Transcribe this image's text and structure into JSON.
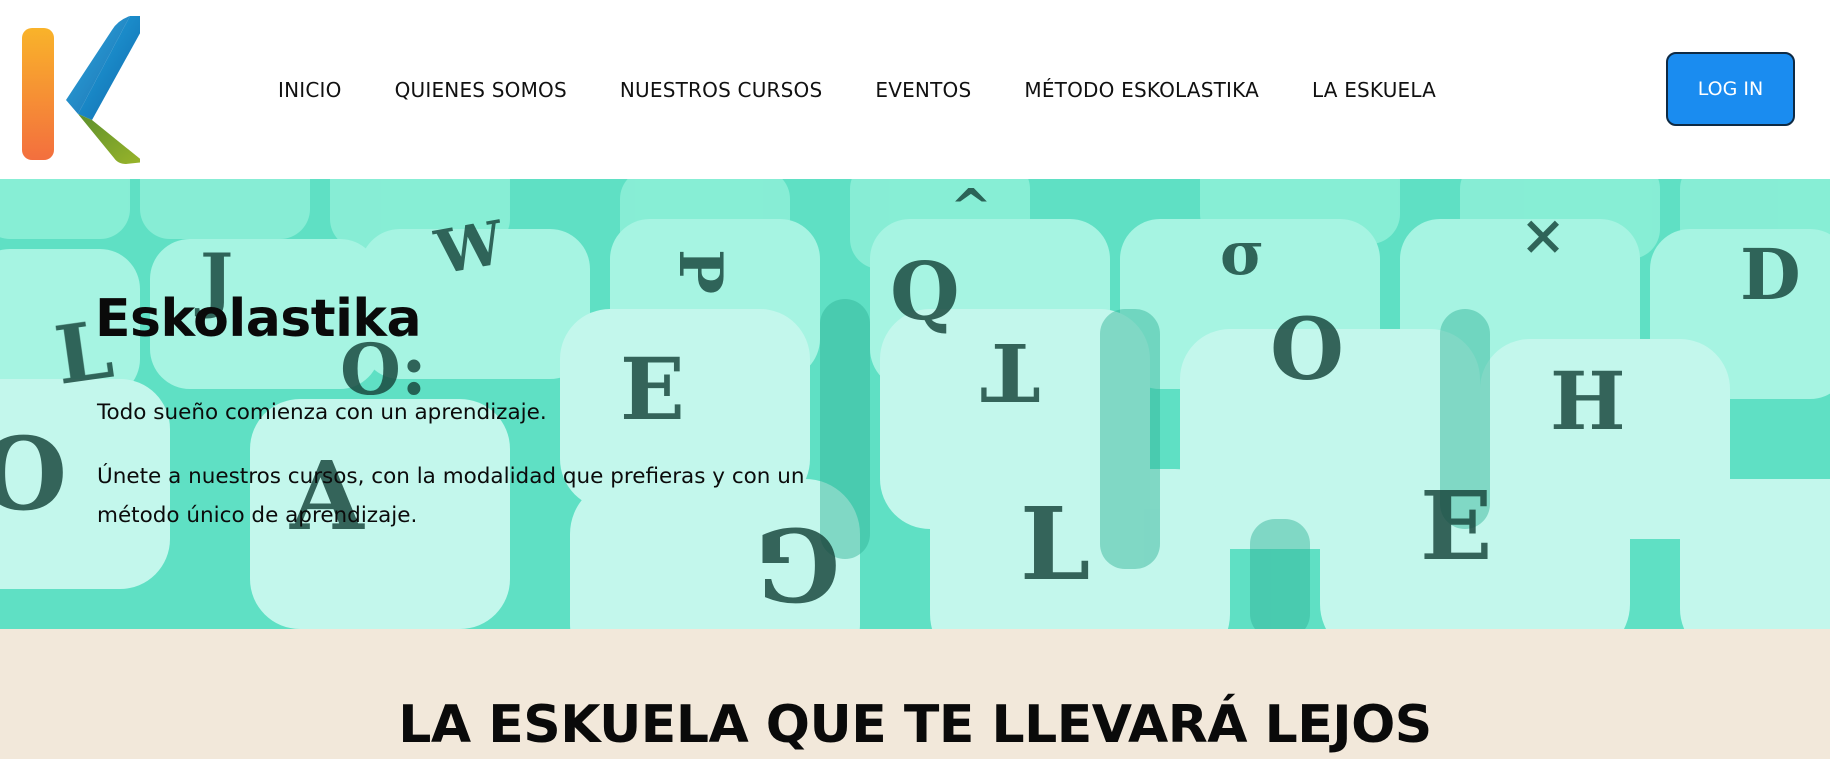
{
  "header": {
    "logo_alt": "Eskolastika logo",
    "nav": [
      {
        "label": "INICIO"
      },
      {
        "label": "QUIENES SOMOS"
      },
      {
        "label": "NUESTROS CURSOS"
      },
      {
        "label": "EVENTOS"
      },
      {
        "label": "MÉTODO ESKOLASTIKA"
      },
      {
        "label": "LA ESKUELA"
      }
    ],
    "login_label": "LOG IN"
  },
  "hero": {
    "title": "Eskolastika",
    "line1": "Todo sueño comienza con un aprendizaje.",
    "line2": "Únete a nuestros cursos, con la modalidad que prefieras y con un método único de aprendizaje.",
    "background_icon": "letter-dice-image",
    "background_color": "#5fe0c4"
  },
  "section": {
    "title": "LA ESKUELA QUE TE LLEVARÁ LEJOS"
  },
  "colors": {
    "accent": "#1a8cf0",
    "section_bg": "#f2e8da",
    "logo_orange": "#f47d3c",
    "logo_blue": "#1d87c9",
    "logo_green": "#7ea52b"
  }
}
